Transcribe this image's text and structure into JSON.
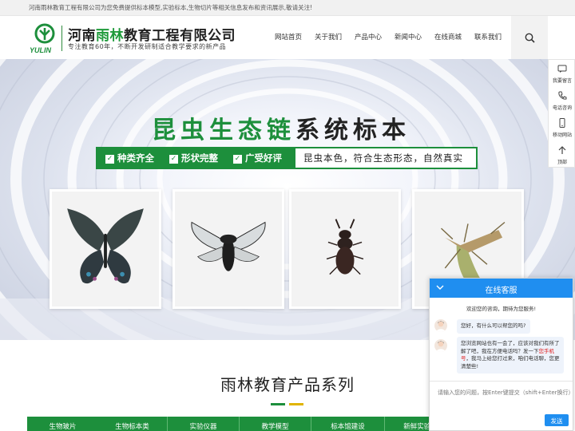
{
  "topbar": {
    "notice": "河南雨林教育工程有限公司为您免费提供标本模型,实验标本,生物切片等相关信息发布和资讯展示,敬请关注!"
  },
  "header": {
    "logo_en": "YULIN",
    "title_part1": "河南",
    "title_part2": "雨林",
    "title_part3": "教育工程有限公司",
    "slogan": "专注教育60年，不断开发研制适合教学要求的新产品",
    "brand_color": "#1d8f3c"
  },
  "nav": {
    "items": [
      {
        "label": "网站首页"
      },
      {
        "label": "关于我们"
      },
      {
        "label": "产品中心"
      },
      {
        "label": "新闻中心"
      },
      {
        "label": "在线商城"
      },
      {
        "label": "联系我们"
      }
    ],
    "search_icon": "search-icon"
  },
  "banner": {
    "headline_green": "昆虫生态链",
    "headline_black": "系统标本",
    "tags": [
      "种类齐全",
      "形状完整",
      "广受好评"
    ],
    "tagline": "昆虫本色，符合生态形态，自然真实",
    "photos": [
      "butterfly",
      "cicada",
      "beetle",
      "mantis"
    ]
  },
  "section": {
    "title": "雨林教育产品系列",
    "tabs": [
      "生物玻片",
      "生物标本类",
      "实验仪器",
      "教学模型",
      "标本馆建设",
      "新鲜实验材"
    ]
  },
  "sidebar": {
    "items": [
      {
        "label": "我要留言",
        "icon": "message-icon"
      },
      {
        "label": "电话咨询",
        "icon": "phone-icon"
      },
      {
        "label": "移动网站",
        "icon": "mobile-icon"
      },
      {
        "label": "顶部",
        "icon": "arrow-up-icon"
      }
    ]
  },
  "chat": {
    "title": "在线客服",
    "welcome": "欢迎您的咨询，期待为您服务!",
    "msg1": "您好，有什么可以帮您的吗?",
    "msg2_a": "您浏览网站也有一会了，应该对我们有所了解了吧，我在方便电话吗？发一下",
    "msg2_hl": "您手机号",
    "msg2_b": "，我马上给您打过来，咱们电话聊，您更清楚些!",
    "input_placeholder": "请输入您的问题，按Enter键提交（shift+Enter换行）",
    "send_label": "发送",
    "accent_color": "#1f8ef0"
  }
}
